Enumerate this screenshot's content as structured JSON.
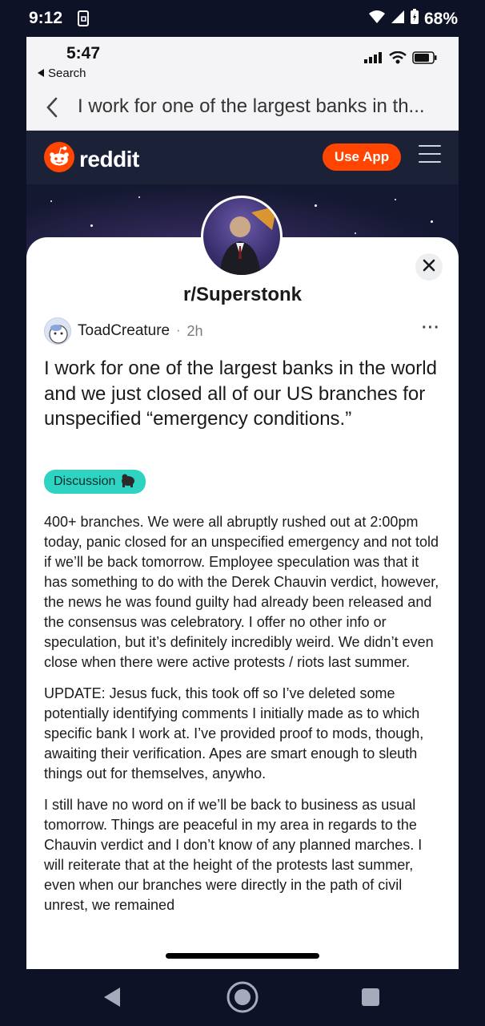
{
  "android_status": {
    "time": "9:12",
    "battery": "68%"
  },
  "ios_status": {
    "time": "5:47",
    "back_label": "Search"
  },
  "nav": {
    "title": "I work for one of the largest banks in th..."
  },
  "header": {
    "logo_text": "reddit",
    "use_app_label": "Use App",
    "accent": "#ff4500"
  },
  "subreddit": {
    "name": "r/Superstonk"
  },
  "post": {
    "author": "ToadCreature",
    "separator": "·",
    "time": "2h",
    "more": "···",
    "title": "I work for one of the largest banks in the world and we just closed all of our US branches for unspecified “emergency conditions.”",
    "flair": "Discussion",
    "flair_color": "#2fd3c2",
    "paragraphs": [
      "400+ branches. We were all abruptly rushed out at 2:00pm today, panic closed for an unspecified emergency and not told if we’ll be back tomorrow. Employee speculation was that it has something to do with the Derek Chauvin verdict, however, the news he was found guilty had already been released and the consensus was celebratory. I offer no other info or speculation, but it’s definitely incredibly weird. We didn’t even close when there were active protests / riots last summer.",
      "UPDATE: Jesus fuck, this took off so I’ve deleted some potentially identifying comments I initially made as to which specific bank I work at. I’ve provided proof to mods, though, awaiting their verification. Apes are smart enough to sleuth things out for themselves, anywho.",
      "I still have no word on if we’ll be back to business as usual tomorrow. Things are peaceful in my area in regards to the Chauvin verdict and I don’t know of any planned marches. I will reiterate that at the height of the protests last summer, even when our branches were directly in the path of civil unrest, we remained"
    ]
  }
}
